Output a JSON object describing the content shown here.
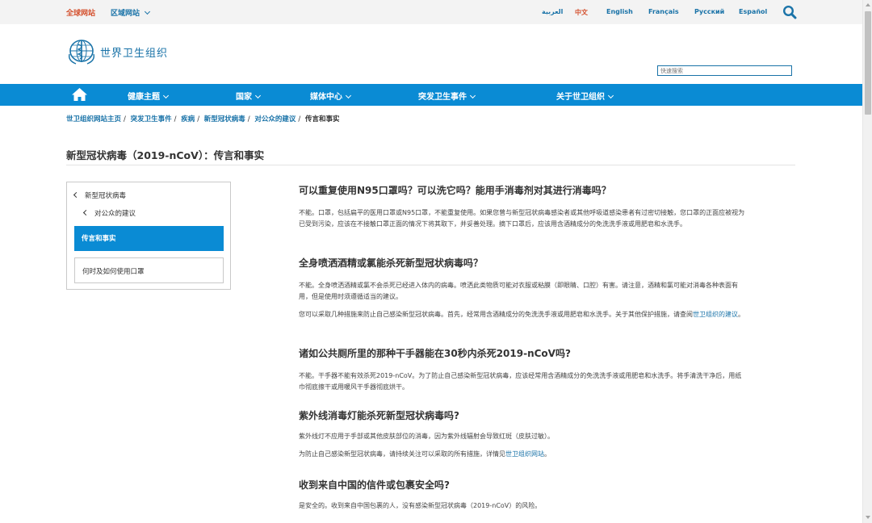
{
  "topbar": {
    "global_site": "全球网站",
    "regional_sites": "区域网站",
    "languages": [
      "العربية",
      "中文",
      "English",
      "Français",
      "Русский",
      "Español"
    ],
    "active_language": "中文"
  },
  "header": {
    "org_name": "世界卫生组织",
    "search_placeholder": "快速搜索"
  },
  "nav": {
    "items": [
      "健康主题",
      "国家",
      "媒体中心",
      "突发卫生事件",
      "关于世卫组织"
    ]
  },
  "breadcrumb": {
    "items": [
      "世卫组织网站主页",
      "突发卫生事件",
      "疾病",
      "新型冠状病毒",
      "对公众的建议"
    ],
    "current": "传言和事实"
  },
  "page_title": "新型冠状病毒（2019-nCoV）：传言和事实",
  "sidebar": {
    "parent": "新型冠状病毒",
    "child": "对公众的建议",
    "active": "传言和事实",
    "other": "何时及如何使用口罩"
  },
  "content": {
    "q1": "可以重复使用N95口罩吗？可以洗它吗？能用手消毒剂对其进行消毒吗？",
    "a1": "不能。口罩，包括扁平的医用口罩或N95口罩，不能重复使用。如果您曾与新型冠状病毒感染者或其他呼吸道感染患者有过密切接触，您口罩的正面应被视为已受到污染，应该在不接触口罩正面的情况下将其取下，并妥善处理。摘下口罩后，应该用含酒精成分的免洗洗手液或用肥皂和水洗手。",
    "q2": "全身喷洒酒精或氯能杀死新型冠状病毒吗？",
    "a2": "不能。全身喷洒酒精或氯不会杀死已经进入体内的病毒。喷洒此类物质可能对衣服或粘膜（即眼睛、口腔）有害。请注意，酒精和氯可能对消毒各种表面有用，但是使用时须遵循适当的建议。",
    "a2b_pre": "您可以采取几种措施来防止自己感染新型冠状病毒。首先，经常用含酒精成分的免洗洗手液或用肥皂和水洗手。关于其他保护措施，请查阅",
    "a2b_link": "世卫组织的建议",
    "a2b_post": "。",
    "q3": "诸如公共厕所里的那种干手器能在30秒内杀死2019-nCoV吗?",
    "a3": "不能。干手器不能有效杀死2019-nCoV。为了防止自己感染新型冠状病毒，应该经常用含酒精成分的免洗洗手液或用肥皂和水洗手。将手清洗干净后，用纸巾彻底擦干或用暖风干手器彻底烘干。",
    "q4": "紫外线消毒灯能杀死新型冠状病毒吗?",
    "a4": "紫外线灯不应用于手部或其他皮肤部位的消毒，因为紫外线辐射会导致红斑（皮肤过敏）。",
    "a4b_pre": "为防止自己感染新型冠状病毒，请持续关注可以采取的所有措施，详情见",
    "a4b_link": "世卫组织网站",
    "a4b_post": "。",
    "q5": "收到来自中国的信件或包裹安全吗?",
    "a5": "是安全的。收到来自中国包裹的人，没有感染新型冠状病毒（2019-nCoV）的风险。"
  },
  "colors": {
    "nav_blue": "#0a8bd4",
    "link_blue": "#1a73a8",
    "accent_orange": "#d4502d"
  }
}
